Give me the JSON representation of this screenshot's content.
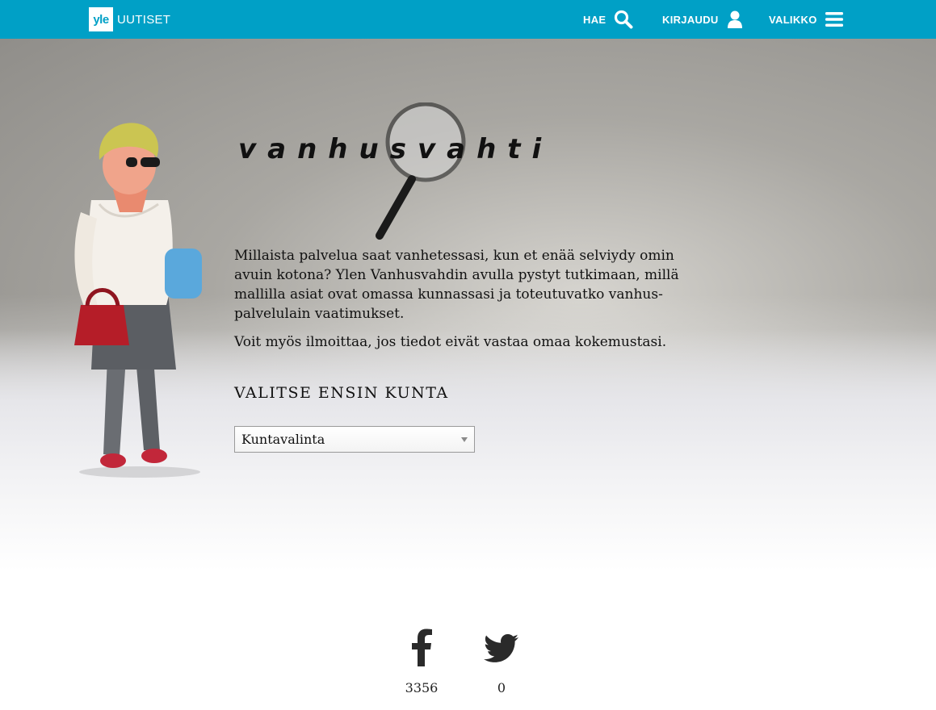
{
  "header": {
    "logo_mark": "yle",
    "logo_text": "UUTISET",
    "search_label": "HAE",
    "login_label": "KIRJAUDU",
    "menu_label": "VALIKKO",
    "brand_color": "#00a0c6"
  },
  "hero": {
    "title": "vanhusvahti",
    "intro_paragraphs": [
      "Millaista palvelua saat vanhetessasi, kun et enää selviydy omin avuin kotona? Ylen Vanhusvahdin avulla pystyt tutkimaan, millä mallilla asiat ovat omassa kunnassasi ja toteutuvatko vanhus-palvelulain vaatimukset.",
      "Voit myös ilmoittaa, jos tiedot eivät vastaa omaa kokemustasi."
    ],
    "section_heading": "VALITSE ENSIN KUNTA",
    "municipality_select": {
      "selected": "Kuntavalinta"
    }
  },
  "share": {
    "facebook_icon": "facebook-icon",
    "facebook_count": "3356",
    "twitter_icon": "twitter-icon",
    "twitter_count": "0"
  }
}
